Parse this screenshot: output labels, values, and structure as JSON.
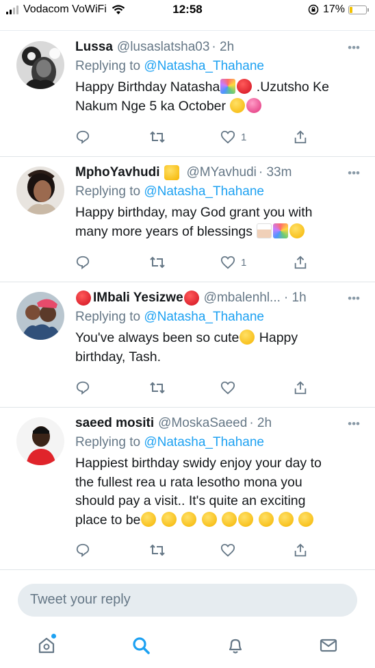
{
  "status_bar": {
    "carrier": "Vodacom VoWiFi",
    "time": "12:58",
    "battery": "17%",
    "battery_level": 0.17
  },
  "tweets": [
    {
      "name": "Lussa",
      "handle": "@lusaslatsha03",
      "time": "· 2h",
      "reply_prefix": "Replying to",
      "reply_to": "@Natasha_Thahane",
      "text_line1": "Happy Birthday Natasha",
      "text_line1b": " .Uzutsho Ke",
      "text_line2": "Nakum Nge 5 ka October",
      "likes": "1"
    },
    {
      "name": "MphoYavhudi",
      "handle": "@MYavhudi",
      "time": "· 33m",
      "reply_prefix": "Replying to",
      "reply_to": "@Natasha_Thahane",
      "text_line1": "Happy birthday, may God grant you with",
      "text_line2": "many more years of blessings",
      "likes": "1"
    },
    {
      "name": "IMbali Yesizwe",
      "handle": "@mbalenhl...",
      "time": "· 1h",
      "reply_prefix": "Replying to",
      "reply_to": "@Natasha_Thahane",
      "text_line1": "You've always been so cute",
      "text_line1b": " Happy",
      "text_line2": "birthday, Tash.",
      "likes": ""
    },
    {
      "name": "saeed mositi",
      "handle": "@MoskaSaeed",
      "time": "· 2h",
      "reply_prefix": "Replying to",
      "reply_to": "@Natasha_Thahane",
      "text_line1": "Happiest birthday swidy enjoy your day to",
      "text_line2": "the fullest rea u rata lesotho mona you",
      "text_line3": "should pay a visit.. It's quite an exciting",
      "text_line4": "place to be",
      "likes": ""
    }
  ],
  "composer": {
    "placeholder": "Tweet your reply"
  },
  "nav": {
    "icons": [
      "home-icon",
      "search-icon",
      "notifications-icon",
      "messages-icon"
    ]
  },
  "colors": {
    "accent": "#1da1f2",
    "secondary_text": "#657786",
    "divider": "#dfe4e8"
  }
}
